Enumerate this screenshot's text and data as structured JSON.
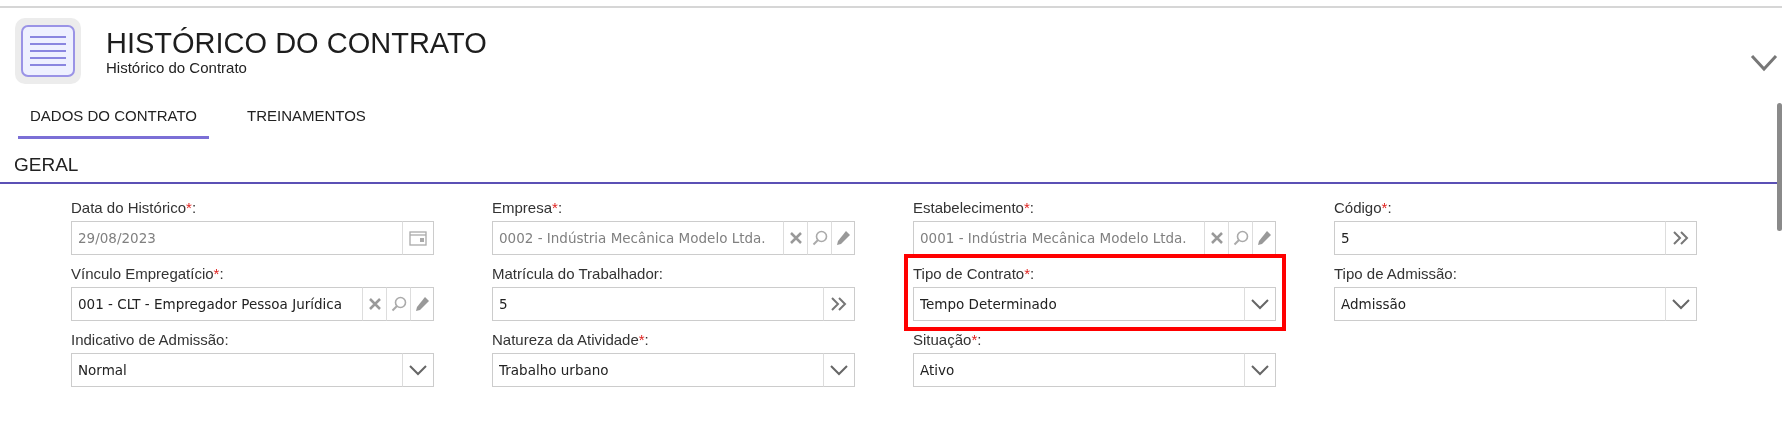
{
  "header": {
    "title": "HISTÓRICO DO CONTRATO",
    "subtitle": "Histórico do Contrato"
  },
  "tabs": [
    {
      "label": "DADOS DO CONTRATO",
      "selected": true
    },
    {
      "label": "TREINAMENTOS",
      "selected": false
    }
  ],
  "section": {
    "title": "GERAL"
  },
  "fields": [
    {
      "label": "Data do Histórico",
      "required_mark": "*",
      "colon": ":",
      "kind": "date",
      "value": "29/08/2023",
      "disabled": true
    },
    {
      "label": "Empresa",
      "required_mark": "*",
      "colon": ":",
      "kind": "lookup",
      "value": "0002 - Indústria Mecânica Modelo Ltda.",
      "disabled": true
    },
    {
      "label": "Estabelecimento",
      "required_mark": "*",
      "colon": ":",
      "kind": "lookup",
      "value": "0001 - Indústria Mecânica Modelo Ltda.",
      "disabled": true
    },
    {
      "label": "Código",
      "required_mark": "*",
      "colon": ":",
      "kind": "code",
      "value": "5",
      "disabled": false
    },
    {
      "label": "Vínculo Empregatício",
      "required_mark": "*",
      "colon": ":",
      "kind": "lookup",
      "value": "001 - CLT - Empregador Pessoa Jurídica",
      "disabled": false
    },
    {
      "label": "Matrícula do Trabalhador",
      "colon": ":",
      "kind": "code",
      "value": "5",
      "disabled": false
    },
    {
      "label": "Tipo de Contrato",
      "required_mark": "*",
      "colon": ":",
      "kind": "select",
      "value": "Tempo Determinado",
      "disabled": false,
      "highlighted": true
    },
    {
      "label": "Tipo de Admissão",
      "colon": ":",
      "kind": "select",
      "value": "Admissão",
      "disabled": false
    },
    {
      "label": "Indicativo de Admissão",
      "colon": ":",
      "kind": "select",
      "value": "Normal",
      "disabled": false
    },
    {
      "label": "Natureza da Atividade",
      "required_mark": "*",
      "colon": ":",
      "kind": "select",
      "value": "Trabalho urbano",
      "disabled": false
    },
    {
      "label": "Situação",
      "required_mark": "*",
      "colon": ":",
      "kind": "select",
      "value": "Ativo",
      "disabled": false
    }
  ]
}
